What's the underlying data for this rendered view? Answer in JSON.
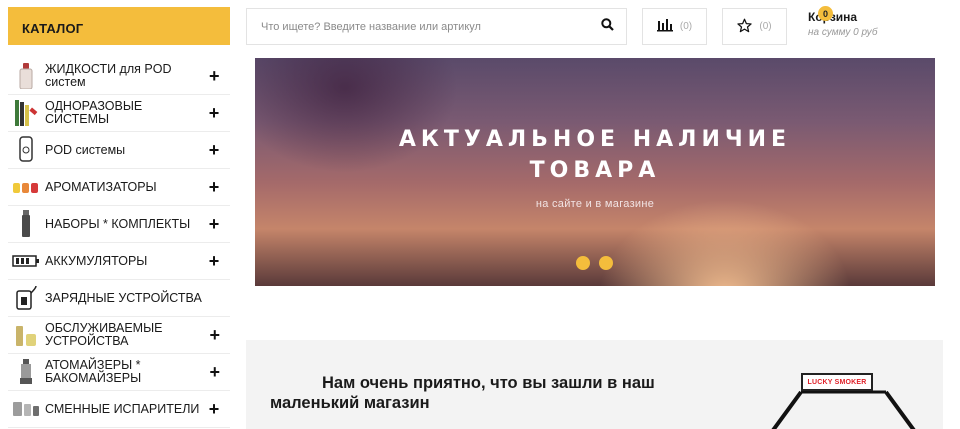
{
  "catalog": {
    "title": "КАТАЛОГ",
    "items": [
      {
        "label": "ЖИДКОСТИ для POD систем",
        "icon": "liquid-bottle-icon",
        "has_plus": true
      },
      {
        "label": "ОДНОРАЗОВЫЕ СИСТЕМЫ",
        "icon": "disposable-vape-icon",
        "has_plus": true
      },
      {
        "label": "POD системы",
        "icon": "pod-device-icon",
        "has_plus": true
      },
      {
        "label": "АРОМАТИЗАТОРЫ",
        "icon": "flavor-bottles-icon",
        "has_plus": true
      },
      {
        "label": "НАБОРЫ * КОМПЛЕКТЫ",
        "icon": "kit-icon",
        "has_plus": true
      },
      {
        "label": "АККУМУЛЯТОРЫ",
        "icon": "battery-icon",
        "has_plus": true
      },
      {
        "label": "ЗАРЯДНЫЕ УСТРОЙСТВА",
        "icon": "charger-icon",
        "has_plus": false
      },
      {
        "label": "ОБСЛУЖИВАЕМЫЕ УСТРОЙСТВА",
        "icon": "serviceable-device-icon",
        "has_plus": true
      },
      {
        "label": "АТОМАЙЗЕРЫ * БАКОМАЙЗЕРЫ",
        "icon": "atomizer-icon",
        "has_plus": true
      },
      {
        "label": "СМЕННЫЕ ИСПАРИТЕЛИ",
        "icon": "coil-icon",
        "has_plus": true
      }
    ],
    "plus_symbol": "+"
  },
  "header": {
    "search_placeholder": "Что ищете? Введите название или артикул",
    "compare_count": "(0)",
    "favorites_count": "(0)",
    "cart_title": "Корзина",
    "cart_sum": "на сумму 0 руб",
    "cart_badge": "0"
  },
  "banner": {
    "title_line1": "АКТУАЛЬНОЕ НАЛИЧИЕ",
    "title_line2": "ТОВАРА",
    "subtitle": "на сайте и в  магазине",
    "slides": 2,
    "dot_color": "#f4bd3c"
  },
  "welcome": {
    "text": "Нам очень приятно, что вы зашли в наш маленький магазин",
    "logo_text": "LUCKY SMOKER"
  },
  "colors": {
    "accent": "#f4bd3c",
    "logo_red": "#e0222a"
  }
}
